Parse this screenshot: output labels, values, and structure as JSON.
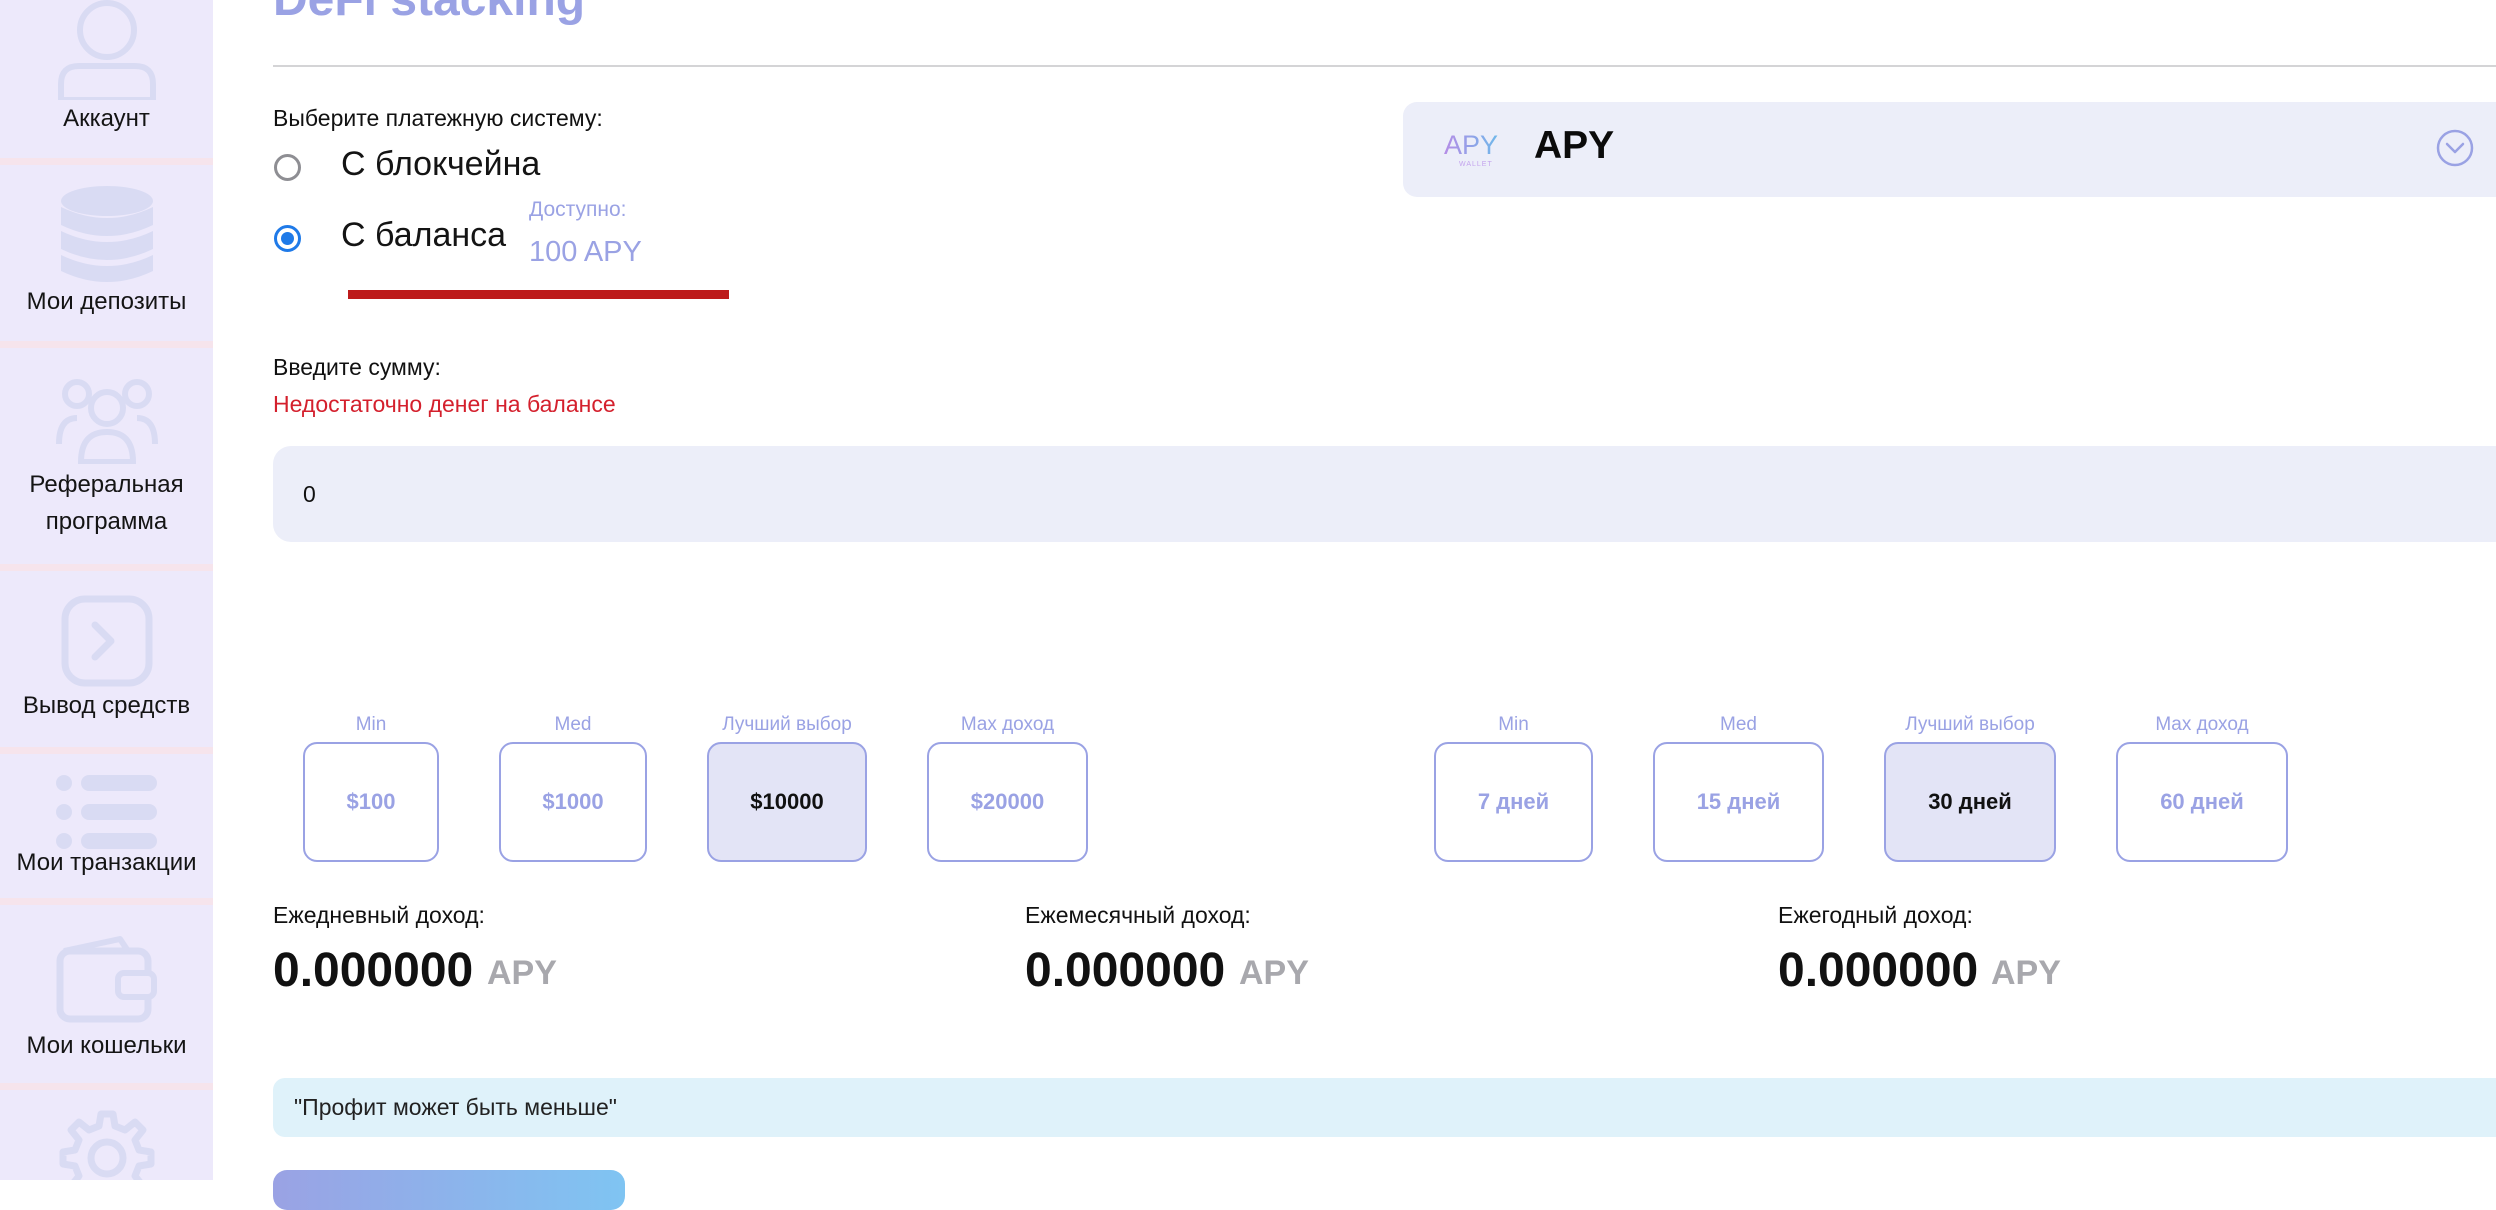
{
  "sidebar": {
    "items": [
      {
        "label": "Аккаунт",
        "icon": "user-icon"
      },
      {
        "label": "Мои депозиты",
        "icon": "coins-stack-icon"
      },
      {
        "label": "Реферальная программа",
        "icon": "users-group-icon"
      },
      {
        "label": "Вывод средств",
        "icon": "withdraw-arrow-icon"
      },
      {
        "label": "Мои транзакции",
        "icon": "list-icon"
      },
      {
        "label": "Мои кошельки",
        "icon": "wallet-icon"
      },
      {
        "label": "",
        "icon": "gear-icon"
      }
    ]
  },
  "header": {
    "title": "DeFi stacking"
  },
  "payment": {
    "prompt": "Выберите платежную систему:",
    "options": [
      {
        "label": "С блокчейна",
        "selected": false
      },
      {
        "label": "С баланса",
        "selected": true
      }
    ],
    "available_caption": "Доступно:",
    "available_value": "100 APY"
  },
  "currency": {
    "logo_text": "APY",
    "logo_subtext": "WALLET",
    "name": "APY"
  },
  "amount": {
    "prompt": "Введите сумму:",
    "error": "Недостаточно денег на балансе",
    "value": "0"
  },
  "amount_options": [
    {
      "caption": "Min",
      "label": "$100",
      "selected": false
    },
    {
      "caption": "Med",
      "label": "$1000",
      "selected": false
    },
    {
      "caption": "Лучший выбор",
      "label": "$10000",
      "selected": true
    },
    {
      "caption": "Max доход",
      "label": "$20000",
      "selected": false
    }
  ],
  "term_options": [
    {
      "caption": "Min",
      "label": "7 дней",
      "selected": false
    },
    {
      "caption": "Med",
      "label": "15 дней",
      "selected": false
    },
    {
      "caption": "Лучший выбор",
      "label": "30 дней",
      "selected": true
    },
    {
      "caption": "Max доход",
      "label": "60 дней",
      "selected": false
    }
  ],
  "income": [
    {
      "label": "Ежедневный доход:",
      "value": "0.000000",
      "unit": "APY"
    },
    {
      "label": "Ежемесячный доход:",
      "value": "0.000000",
      "unit": "APY"
    },
    {
      "label": "Ежегодный доход:",
      "value": "0.000000",
      "unit": "APY"
    }
  ],
  "notice": "\"Профит может быть меньше\"",
  "colors": {
    "accent": "#9aa2e4",
    "error": "#d4202d",
    "radio_active": "#1f7ae8",
    "sidebar_bg": "#ede9fb",
    "notice_bg": "#dff2fa"
  }
}
